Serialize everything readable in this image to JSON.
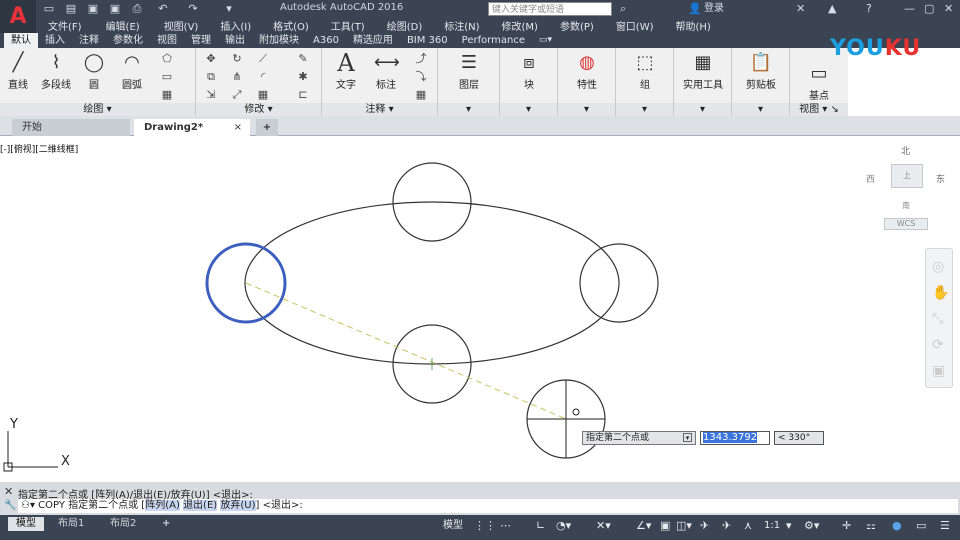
{
  "app": {
    "title": "Autodesk AutoCAD 2016",
    "search_placeholder": "键入关键字或短语",
    "login": "登录",
    "logo_letter": "A"
  },
  "menu": [
    "文件(F)",
    "编辑(E)",
    "视图(V)",
    "插入(I)",
    "格式(O)",
    "工具(T)",
    "绘图(D)",
    "标注(N)",
    "修改(M)",
    "参数(P)",
    "窗口(W)",
    "帮助(H)"
  ],
  "ribbon_tabs": [
    "默认",
    "插入",
    "注释",
    "参数化",
    "视图",
    "管理",
    "输出",
    "附加模块",
    "A360",
    "精选应用",
    "BIM 360",
    "Performance"
  ],
  "draw_panel": {
    "title": "绘图",
    "buttons": [
      "直线",
      "多段线",
      "圆",
      "圆弧"
    ]
  },
  "modify_panel": {
    "title": "修改"
  },
  "annotation_panel": {
    "title": "注释",
    "buttons": [
      "文字",
      "标注"
    ]
  },
  "big_buttons": [
    "图层",
    "块",
    "特性",
    "组",
    "实用工具",
    "剪贴板",
    "基点"
  ],
  "view_panel_title": "视图",
  "doc_tabs": [
    "开始",
    "Drawing2*"
  ],
  "view_label": "[-][俯视][二维线框]",
  "viewcube": {
    "north": "北",
    "south": "南",
    "east": "东",
    "west": "西",
    "center": "上",
    "wcs": "WCS"
  },
  "ucs": {
    "x": "X",
    "y": "Y"
  },
  "dynamic_input": {
    "prompt": "指定第二个点或",
    "distance": "1343.3792",
    "angle": "< 330°"
  },
  "command": {
    "history": "指定第二个点或 [阵列(A)/退出(E)/放弃(U)] <退出>:",
    "prefix": "COPY 指定第二个点或",
    "options": [
      "阵列(A)",
      "退出(E)",
      "放弃(U)"
    ],
    "suffix": "<退出>:"
  },
  "layout_tabs": [
    "模型",
    "布局1",
    "布局2"
  ],
  "status": {
    "model": "模型",
    "scale": "1:1"
  },
  "watermark": "YOUKU",
  "colors": {
    "titlebar": "#3b4453",
    "accent": "#e8323a",
    "selection": "#1f3fa6",
    "dash_line": "#c8c060"
  }
}
